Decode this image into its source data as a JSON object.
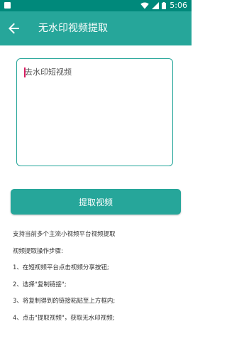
{
  "status_bar": {
    "time": "5:06",
    "icons": [
      "notification-icon",
      "wifi-icon",
      "signal-icon",
      "battery-icon"
    ],
    "background": "#00897b"
  },
  "app_bar": {
    "title": "无水印视频提取",
    "back_icon": "arrow-left-icon",
    "background": "#26a69a"
  },
  "input": {
    "value": "",
    "placeholder": "去水印短视频",
    "border_color": "#26a69a",
    "cursor_color": "#d81b60"
  },
  "extract_button": {
    "label": "提取视频",
    "color": "#26a69a"
  },
  "instructions": {
    "intro": "支持当前多个主流小视频平台视频提取",
    "heading": "视频提取操作步骤:",
    "steps": [
      "1、在短视频平台点击视频分享按钮;",
      "2、选择\"复制链接\";",
      "3、将复制得到的链接粘贴至上方框内;",
      "4、点击\"提取视频\"，获取无水印视频;"
    ]
  }
}
